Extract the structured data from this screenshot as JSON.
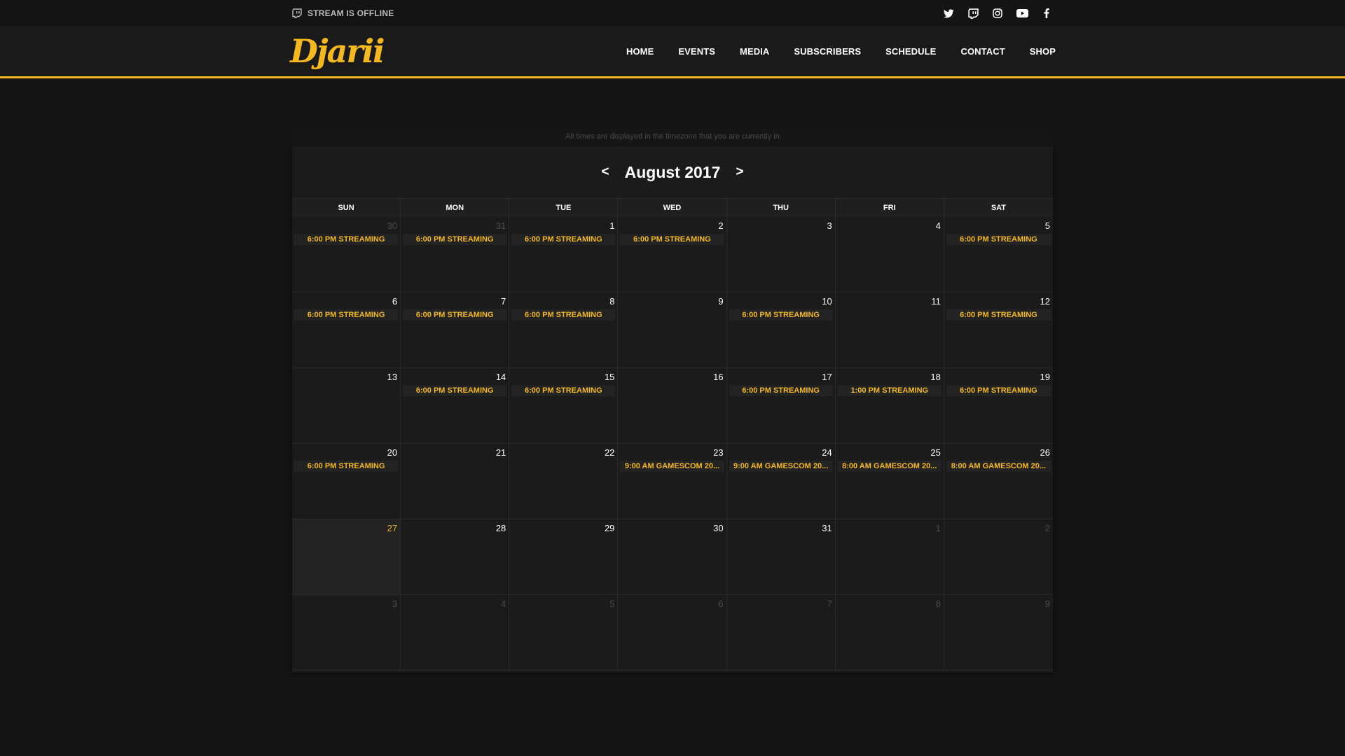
{
  "topbar": {
    "status_text": "STREAM IS OFFLINE",
    "status_icon": "twitch-icon",
    "socials": [
      "twitter-icon",
      "twitch-icon",
      "instagram-icon",
      "youtube-icon",
      "facebook-icon"
    ]
  },
  "header": {
    "logo": "Djarii",
    "accent_color": "#f5b91f",
    "nav": [
      "HOME",
      "EVENTS",
      "MEDIA",
      "SUBSCRIBERS",
      "SCHEDULE",
      "CONTACT",
      "SHOP"
    ]
  },
  "calendar": {
    "timezone_note": "All times are displayed in the timezone that you are currently in",
    "prev_label": "<",
    "next_label": ">",
    "month_label": "August 2017",
    "weekdays": [
      "SUN",
      "MON",
      "TUE",
      "WED",
      "THU",
      "FRI",
      "SAT"
    ],
    "days": [
      {
        "n": "30",
        "other": true,
        "event": "6:00 PM STREAMING"
      },
      {
        "n": "31",
        "other": true,
        "event": "6:00 PM STREAMING"
      },
      {
        "n": "1",
        "event": "6:00 PM STREAMING"
      },
      {
        "n": "2",
        "event": "6:00 PM STREAMING"
      },
      {
        "n": "3"
      },
      {
        "n": "4"
      },
      {
        "n": "5",
        "event": "6:00 PM STREAMING"
      },
      {
        "n": "6",
        "event": "6:00 PM STREAMING"
      },
      {
        "n": "7",
        "event": "6:00 PM STREAMING"
      },
      {
        "n": "8",
        "event": "6:00 PM STREAMING"
      },
      {
        "n": "9"
      },
      {
        "n": "10",
        "event": "6:00 PM STREAMING"
      },
      {
        "n": "11"
      },
      {
        "n": "12",
        "event": "6:00 PM STREAMING"
      },
      {
        "n": "13"
      },
      {
        "n": "14",
        "event": "6:00 PM STREAMING"
      },
      {
        "n": "15",
        "event": "6:00 PM STREAMING"
      },
      {
        "n": "16"
      },
      {
        "n": "17",
        "event": "6:00 PM STREAMING"
      },
      {
        "n": "18",
        "event": "1:00 PM STREAMING"
      },
      {
        "n": "19",
        "event": "6:00 PM STREAMING"
      },
      {
        "n": "20",
        "event": "6:00 PM STREAMING"
      },
      {
        "n": "21"
      },
      {
        "n": "22"
      },
      {
        "n": "23",
        "event": "9:00 AM GAMESCOM 20..."
      },
      {
        "n": "24",
        "event": "9:00 AM GAMESCOM 20..."
      },
      {
        "n": "25",
        "event": "8:00 AM GAMESCOM 20..."
      },
      {
        "n": "26",
        "event": "8:00 AM GAMESCOM 20..."
      },
      {
        "n": "27",
        "today": true
      },
      {
        "n": "28"
      },
      {
        "n": "29"
      },
      {
        "n": "30"
      },
      {
        "n": "31"
      },
      {
        "n": "1",
        "other": true
      },
      {
        "n": "2",
        "other": true
      },
      {
        "n": "3",
        "other": true
      },
      {
        "n": "4",
        "other": true
      },
      {
        "n": "5",
        "other": true
      },
      {
        "n": "6",
        "other": true
      },
      {
        "n": "7",
        "other": true
      },
      {
        "n": "8",
        "other": true
      },
      {
        "n": "9",
        "other": true
      }
    ]
  }
}
